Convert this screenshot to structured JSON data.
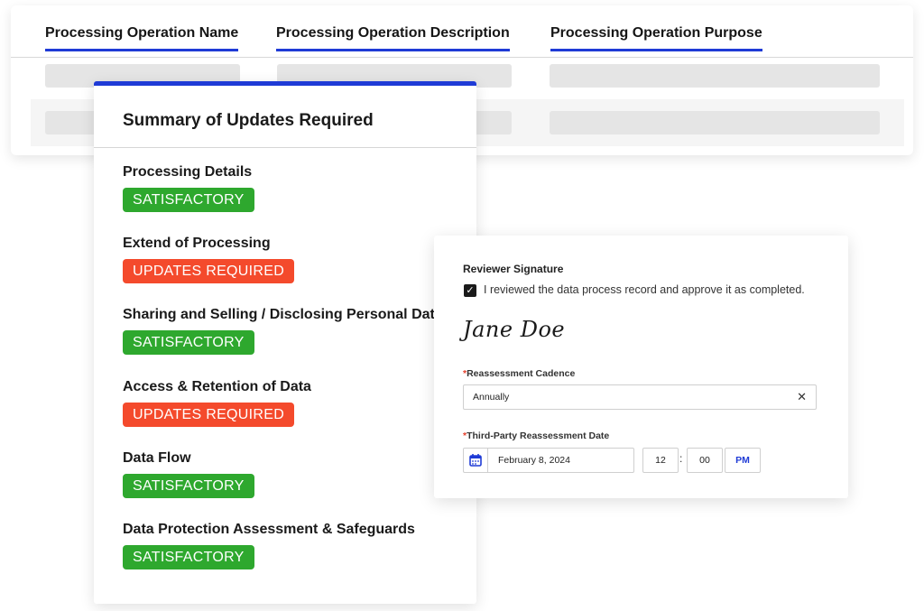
{
  "table": {
    "columns": [
      {
        "label": "Processing Operation Name"
      },
      {
        "label": "Processing Operation Description"
      },
      {
        "label": "Processing Operation Purpose"
      }
    ]
  },
  "summary": {
    "title": "Summary of Updates Required",
    "sections": [
      {
        "title": "Processing Details",
        "status": "SATISFACTORY"
      },
      {
        "title": "Extend of Processing",
        "status": "UPDATES REQUIRED"
      },
      {
        "title": "Sharing and Selling / Disclosing Personal Data",
        "status": "SATISFACTORY"
      },
      {
        "title": "Access & Retention of Data",
        "status": "UPDATES REQUIRED"
      },
      {
        "title": "Data Flow",
        "status": "SATISFACTORY"
      },
      {
        "title": "Data Protection Assessment & Safeguards",
        "status": "SATISFACTORY"
      }
    ]
  },
  "review": {
    "signature_label": "Reviewer Signature",
    "approval_text": "I reviewed the data process record and approve it as completed.",
    "approval_checked": true,
    "signature": "Jane Doe",
    "cadence_label": "Reassessment Cadence",
    "cadence_value": "Annually",
    "date_label": "Third-Party Reassessment Date",
    "date_value": "February 8, 2024",
    "hour": "12",
    "minute": "00",
    "colon": ":",
    "ampm": "PM",
    "required_marker": "*"
  },
  "colors": {
    "accent": "#1f3bd6",
    "satisfactory": "#2ea82e",
    "updates_required": "#f44a2c"
  }
}
